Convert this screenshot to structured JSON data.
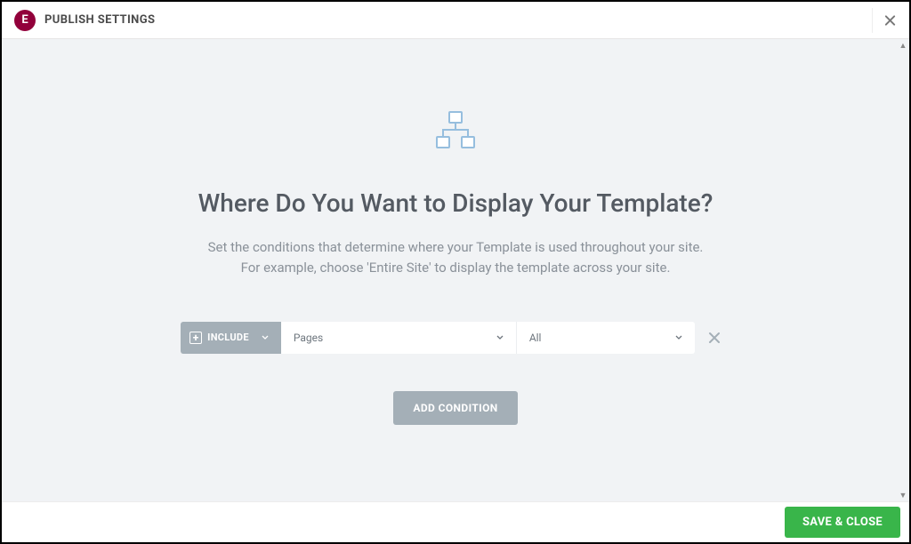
{
  "header": {
    "title": "PUBLISH SETTINGS"
  },
  "main": {
    "heading": "Where Do You Want to Display Your Template?",
    "description_line1": "Set the conditions that determine where your Template is used throughout your site.",
    "description_line2": "For example, choose 'Entire Site' to display the template across your site."
  },
  "condition_row": {
    "mode_label": "INCLUDE",
    "scope_value": "Pages",
    "filter_value": "All"
  },
  "actions": {
    "add_condition": "ADD CONDITION",
    "save_close": "SAVE & CLOSE"
  },
  "colors": {
    "brand": "#92003B",
    "muted": "#a4afb7",
    "primary": "#39b54a"
  }
}
